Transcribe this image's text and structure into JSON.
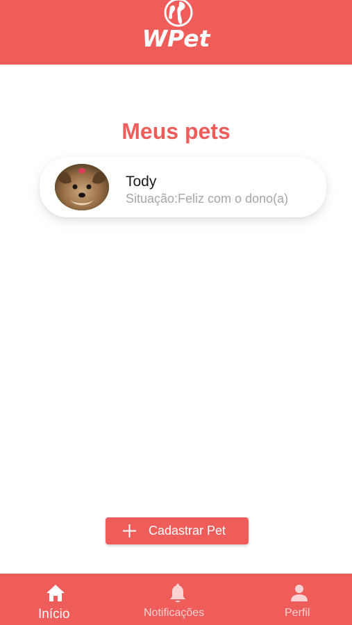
{
  "header": {
    "logo_icon": "globe-icon",
    "app_name": "WPet",
    "bg_color": "#ef5d5b"
  },
  "main": {
    "title": "Meus pets",
    "pets": [
      {
        "name": "Tody",
        "status": "Situação:Feliz com o dono(a)",
        "avatar": "dog-photo"
      }
    ],
    "add_button": {
      "icon": "plus-icon",
      "label": "Cadastrar Pet"
    }
  },
  "bottom_nav": {
    "items": [
      {
        "icon": "home-icon",
        "label": "Início",
        "active": true
      },
      {
        "icon": "bell-icon",
        "label": "Notificações",
        "active": false
      },
      {
        "icon": "user-icon",
        "label": "Perfil",
        "active": false
      }
    ]
  },
  "colors": {
    "accent": "#ef5d5b",
    "status_text": "#a6a6a6",
    "inactive_nav": "#fbd3d2"
  }
}
